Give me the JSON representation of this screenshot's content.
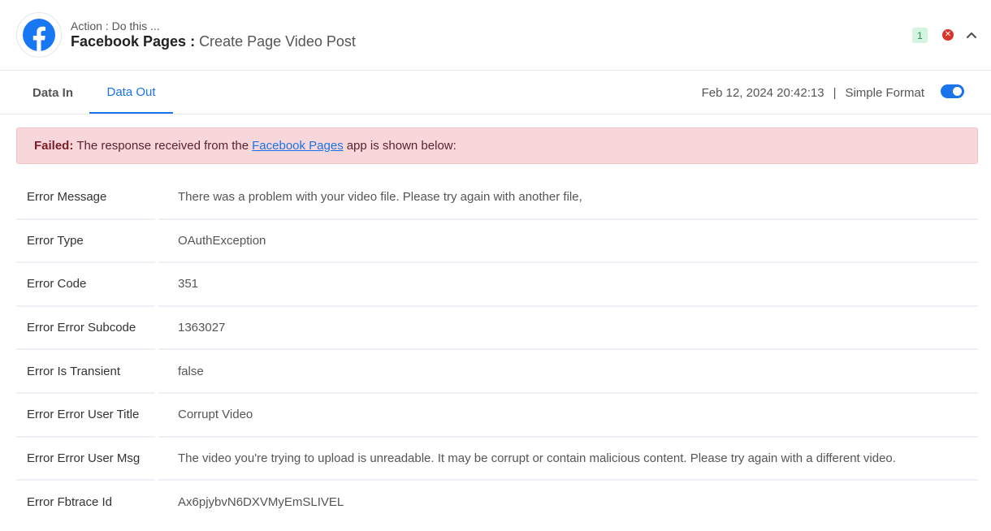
{
  "header": {
    "action_label": "Action : Do this ...",
    "app_name": "Facebook Pages",
    "separator": " : ",
    "event_name": "Create Page Video Post",
    "step_badge": "1",
    "logo_icon": "facebook-logo-icon",
    "brand_color": "#1877f2"
  },
  "tabs": [
    {
      "label": "Data In",
      "active": false
    },
    {
      "label": "Data Out",
      "active": true
    }
  ],
  "meta": {
    "timestamp": "Feb 12, 2024 20:42:13",
    "separator": "|",
    "format_label": "Simple Format",
    "format_enabled": true
  },
  "alert": {
    "status": "Failed:",
    "text_before": "The response received from the",
    "link_text": "Facebook Pages",
    "text_after": "app is shown below:",
    "background": "#f7d7da"
  },
  "rows": [
    {
      "key": "Error Message",
      "value": "There was a problem with your video file. Please try again with another file,"
    },
    {
      "key": "Error Type",
      "value": "OAuthException"
    },
    {
      "key": "Error Code",
      "value": "351"
    },
    {
      "key": "Error Error Subcode",
      "value": "1363027"
    },
    {
      "key": "Error Is Transient",
      "value": "false"
    },
    {
      "key": "Error Error User Title",
      "value": "Corrupt Video"
    },
    {
      "key": "Error Error User Msg",
      "value": "The video you're trying to upload is unreadable. It may be corrupt or contain malicious content. Please try again with a different video."
    },
    {
      "key": "Error Fbtrace Id",
      "value": "Ax6pjybvN6DXVMyEmSLIVEL"
    }
  ]
}
